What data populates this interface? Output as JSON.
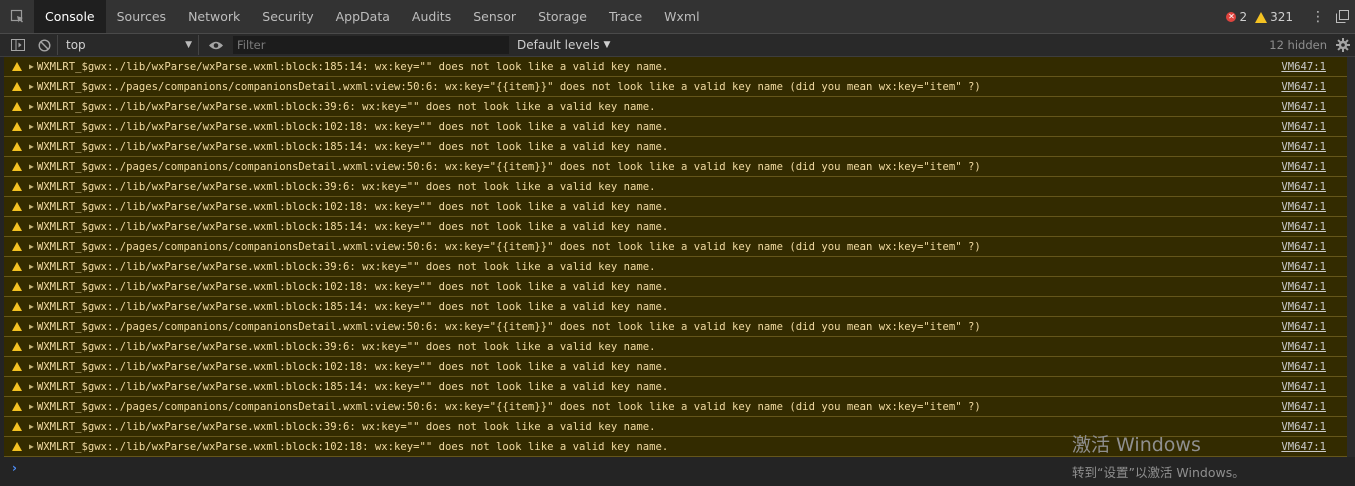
{
  "tabs": [
    {
      "label": "Console",
      "active": true
    },
    {
      "label": "Sources"
    },
    {
      "label": "Network"
    },
    {
      "label": "Security"
    },
    {
      "label": "AppData"
    },
    {
      "label": "Audits"
    },
    {
      "label": "Sensor"
    },
    {
      "label": "Storage"
    },
    {
      "label": "Trace"
    },
    {
      "label": "Wxml"
    }
  ],
  "status": {
    "errors": "2",
    "warnings": "321"
  },
  "toolbar": {
    "context": "top",
    "filter_placeholder": "Filter",
    "levels": "Default levels",
    "hidden": "12 hidden"
  },
  "messages": [
    {
      "text": "WXMLRT_$gwx:./lib/wxParse/wxParse.wxml:block:185:14: wx:key=\"\" does not look like a valid key name.",
      "source": "VM647:1"
    },
    {
      "text": "WXMLRT_$gwx:./pages/companions/companionsDetail.wxml:view:50:6: wx:key=\"{{item}}\" does not look like a valid key name (did you mean wx:key=\"item\" ?)",
      "source": "VM647:1"
    },
    {
      "text": "WXMLRT_$gwx:./lib/wxParse/wxParse.wxml:block:39:6: wx:key=\"\" does not look like a valid key name.",
      "source": "VM647:1"
    },
    {
      "text": "WXMLRT_$gwx:./lib/wxParse/wxParse.wxml:block:102:18: wx:key=\"\" does not look like a valid key name.",
      "source": "VM647:1"
    },
    {
      "text": "WXMLRT_$gwx:./lib/wxParse/wxParse.wxml:block:185:14: wx:key=\"\" does not look like a valid key name.",
      "source": "VM647:1"
    },
    {
      "text": "WXMLRT_$gwx:./pages/companions/companionsDetail.wxml:view:50:6: wx:key=\"{{item}}\" does not look like a valid key name (did you mean wx:key=\"item\" ?)",
      "source": "VM647:1"
    },
    {
      "text": "WXMLRT_$gwx:./lib/wxParse/wxParse.wxml:block:39:6: wx:key=\"\" does not look like a valid key name.",
      "source": "VM647:1"
    },
    {
      "text": "WXMLRT_$gwx:./lib/wxParse/wxParse.wxml:block:102:18: wx:key=\"\" does not look like a valid key name.",
      "source": "VM647:1"
    },
    {
      "text": "WXMLRT_$gwx:./lib/wxParse/wxParse.wxml:block:185:14: wx:key=\"\" does not look like a valid key name.",
      "source": "VM647:1"
    },
    {
      "text": "WXMLRT_$gwx:./pages/companions/companionsDetail.wxml:view:50:6: wx:key=\"{{item}}\" does not look like a valid key name (did you mean wx:key=\"item\" ?)",
      "source": "VM647:1"
    },
    {
      "text": "WXMLRT_$gwx:./lib/wxParse/wxParse.wxml:block:39:6: wx:key=\"\" does not look like a valid key name.",
      "source": "VM647:1"
    },
    {
      "text": "WXMLRT_$gwx:./lib/wxParse/wxParse.wxml:block:102:18: wx:key=\"\" does not look like a valid key name.",
      "source": "VM647:1"
    },
    {
      "text": "WXMLRT_$gwx:./lib/wxParse/wxParse.wxml:block:185:14: wx:key=\"\" does not look like a valid key name.",
      "source": "VM647:1"
    },
    {
      "text": "WXMLRT_$gwx:./pages/companions/companionsDetail.wxml:view:50:6: wx:key=\"{{item}}\" does not look like a valid key name (did you mean wx:key=\"item\" ?)",
      "source": "VM647:1"
    },
    {
      "text": "WXMLRT_$gwx:./lib/wxParse/wxParse.wxml:block:39:6: wx:key=\"\" does not look like a valid key name.",
      "source": "VM647:1"
    },
    {
      "text": "WXMLRT_$gwx:./lib/wxParse/wxParse.wxml:block:102:18: wx:key=\"\" does not look like a valid key name.",
      "source": "VM647:1"
    },
    {
      "text": "WXMLRT_$gwx:./lib/wxParse/wxParse.wxml:block:185:14: wx:key=\"\" does not look like a valid key name.",
      "source": "VM647:1"
    },
    {
      "text": "WXMLRT_$gwx:./pages/companions/companionsDetail.wxml:view:50:6: wx:key=\"{{item}}\" does not look like a valid key name (did you mean wx:key=\"item\" ?)",
      "source": "VM647:1"
    },
    {
      "text": "WXMLRT_$gwx:./lib/wxParse/wxParse.wxml:block:39:6: wx:key=\"\" does not look like a valid key name.",
      "source": "VM647:1"
    },
    {
      "text": "WXMLRT_$gwx:./lib/wxParse/wxParse.wxml:block:102:18: wx:key=\"\" does not look like a valid key name.",
      "source": "VM647:1"
    }
  ],
  "watermark": {
    "line1": "激活 Windows",
    "line2": "转到“设置”以激活 Windows。"
  },
  "colors": {
    "warning_bg": "#332b00",
    "warning_border": "#65561a",
    "warning_text": "#f0d9a0",
    "prompt": "#4d8ef7"
  }
}
